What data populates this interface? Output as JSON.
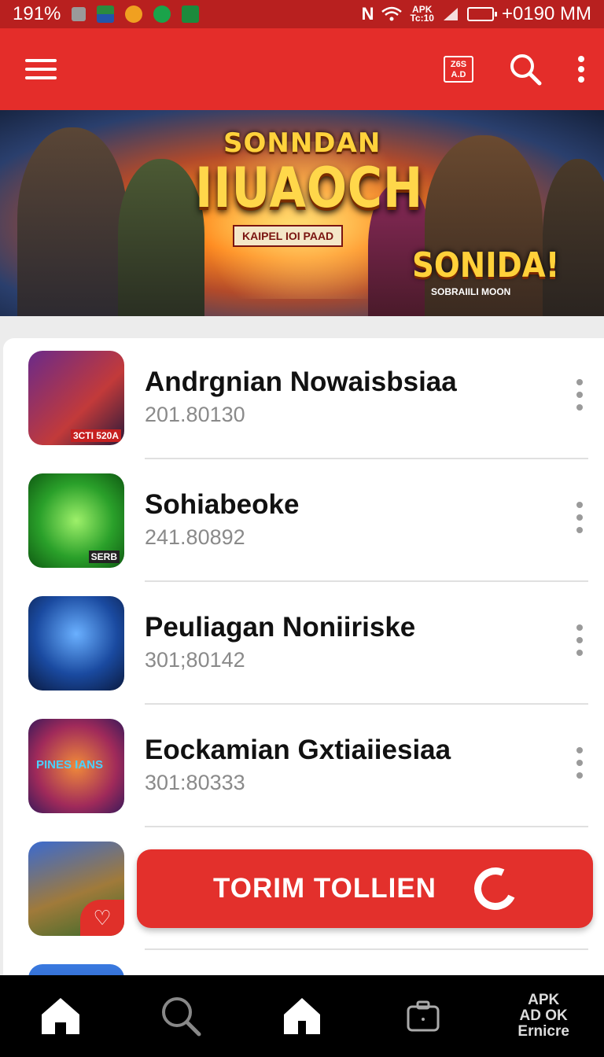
{
  "status_bar": {
    "battery_text": "191%",
    "network_label": "APK",
    "network_sub": "Tc:10",
    "time": "+0190 MM"
  },
  "app_bar": {
    "badge_text": "Z6S A.D"
  },
  "banner": {
    "title_small": "SONNDAN",
    "title_big": "IIUAOCH",
    "subtitle": "KAIPEL IOI PAAD",
    "cta_text": "SONIDA!",
    "cta_sub": "SOBRAIILI MOON"
  },
  "apps": [
    {
      "name": "Andrgnian Nowaisbsiaa",
      "meta": "201.80130",
      "thumb_text": "3CTI 520A"
    },
    {
      "name": "Sohiabeoke",
      "meta": "241.80892",
      "thumb_text": "SERB"
    },
    {
      "name": "Peuliagan Noniiriske",
      "meta": "301;80142",
      "thumb_text": ""
    },
    {
      "name": "Eockamian Gxtiaiiesiaa",
      "meta": "301:80333",
      "thumb_text": "PINES IANS"
    },
    {
      "name": "",
      "meta": "",
      "thumb_text": ""
    }
  ],
  "cta": {
    "label": "TORIM TOLLIEN"
  },
  "bottom_nav": {
    "apk_lines": [
      "APK",
      "AD OK",
      "Ernicre"
    ]
  },
  "colors": {
    "primary": "#e42d2a",
    "status": "#b8201f",
    "nav": "#000000"
  }
}
